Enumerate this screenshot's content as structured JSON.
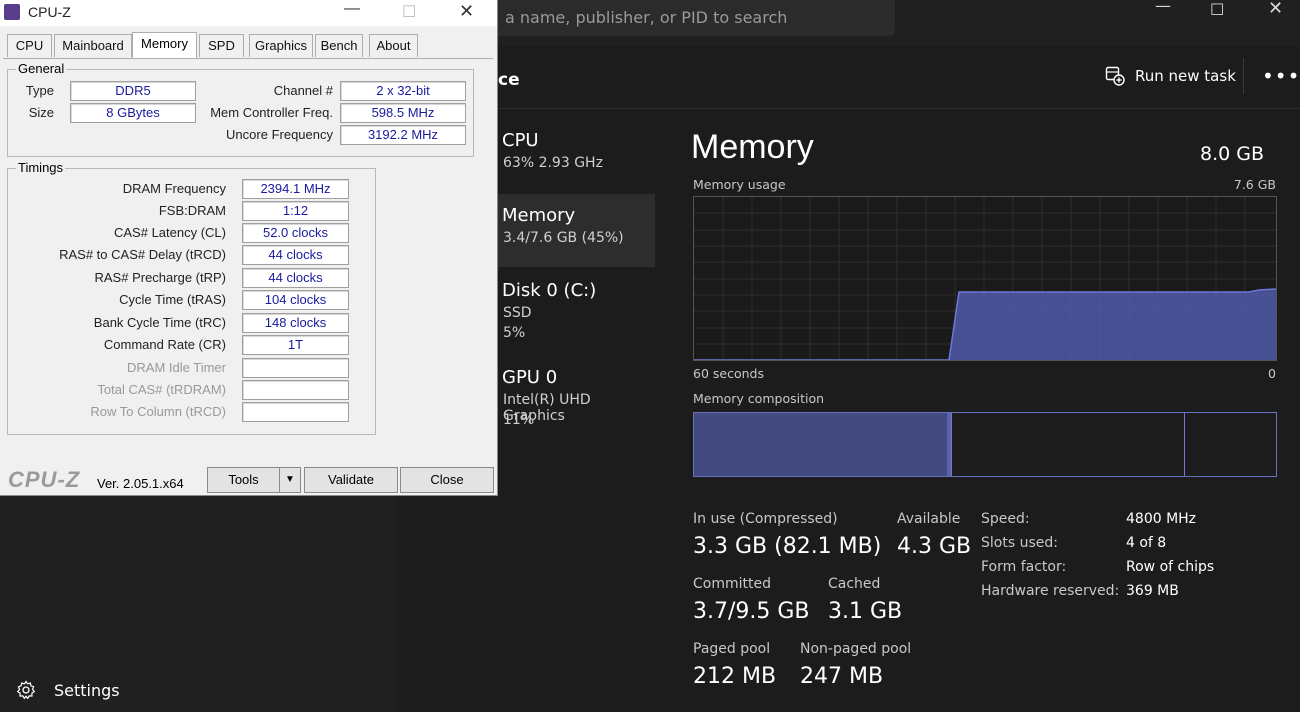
{
  "taskmgr": {
    "search_placeholder": "a name, publisher, or PID to search",
    "section_title": "ce",
    "run_new_task": "Run new task",
    "more": "•••",
    "settings": "Settings",
    "sidebar": [
      {
        "title": "CPU",
        "line1": "63%  2.93 GHz",
        "line2": ""
      },
      {
        "title": "Memory",
        "line1": "3.4/7.6 GB (45%)",
        "line2": ""
      },
      {
        "title": "Disk 0 (C:)",
        "line1": "SSD",
        "line2": "5%"
      },
      {
        "title": "GPU 0",
        "line1": "Intel(R) UHD Graphics",
        "line2": "11%"
      }
    ],
    "memory": {
      "title": "Memory",
      "total": "8.0 GB",
      "usage_label": "Memory usage",
      "usage_max": "7.6 GB",
      "x_left": "60 seconds",
      "x_right": "0",
      "composition_label": "Memory composition",
      "in_use_label": "In use (Compressed)",
      "in_use_value": "3.3 GB (82.1 MB)",
      "available_label": "Available",
      "available_value": "4.3 GB",
      "committed_label": "Committed",
      "committed_value": "3.7/9.5 GB",
      "cached_label": "Cached",
      "cached_value": "3.1 GB",
      "paged_label": "Paged pool",
      "paged_value": "212 MB",
      "nonpaged_label": "Non-paged pool",
      "nonpaged_value": "247 MB",
      "info": [
        {
          "k": "Speed:",
          "v": "4800 MHz"
        },
        {
          "k": "Slots used:",
          "v": "4 of 8"
        },
        {
          "k": "Form factor:",
          "v": "Row of chips"
        },
        {
          "k": "Hardware reserved:",
          "v": "369 MB"
        }
      ]
    },
    "colors": {
      "accent": "#6f78d8",
      "fill": "#4f5aa8"
    }
  },
  "cpuz": {
    "title": "CPU-Z",
    "tabs": [
      "CPU",
      "Mainboard",
      "Memory",
      "SPD",
      "Graphics",
      "Bench",
      "About"
    ],
    "active_tab": "Memory",
    "general": {
      "label": "General",
      "type_key": "Type",
      "type_val": "DDR5",
      "size_key": "Size",
      "size_val": "8 GBytes",
      "channel_key": "Channel #",
      "channel_val": "2 x 32-bit",
      "memctrl_key": "Mem Controller Freq.",
      "memctrl_val": "598.5 MHz",
      "uncore_key": "Uncore Frequency",
      "uncore_val": "3192.2 MHz"
    },
    "timings": {
      "label": "Timings",
      "rows": [
        {
          "k": "DRAM Frequency",
          "v": "2394.1 MHz"
        },
        {
          "k": "FSB:DRAM",
          "v": "1:12"
        },
        {
          "k": "CAS# Latency (CL)",
          "v": "52.0 clocks"
        },
        {
          "k": "RAS# to CAS# Delay (tRCD)",
          "v": "44 clocks"
        },
        {
          "k": "RAS# Precharge (tRP)",
          "v": "44 clocks"
        },
        {
          "k": "Cycle Time (tRAS)",
          "v": "104 clocks"
        },
        {
          "k": "Bank Cycle Time (tRC)",
          "v": "148 clocks"
        },
        {
          "k": "Command Rate (CR)",
          "v": "1T"
        },
        {
          "k": "DRAM Idle Timer",
          "v": ""
        },
        {
          "k": "Total CAS# (tRDRAM)",
          "v": ""
        },
        {
          "k": "Row To Column (tRCD)",
          "v": ""
        }
      ]
    },
    "brand": "CPU-Z",
    "version": "Ver. 2.05.1.x64",
    "tools": "Tools",
    "validate": "Validate",
    "close": "Close"
  }
}
